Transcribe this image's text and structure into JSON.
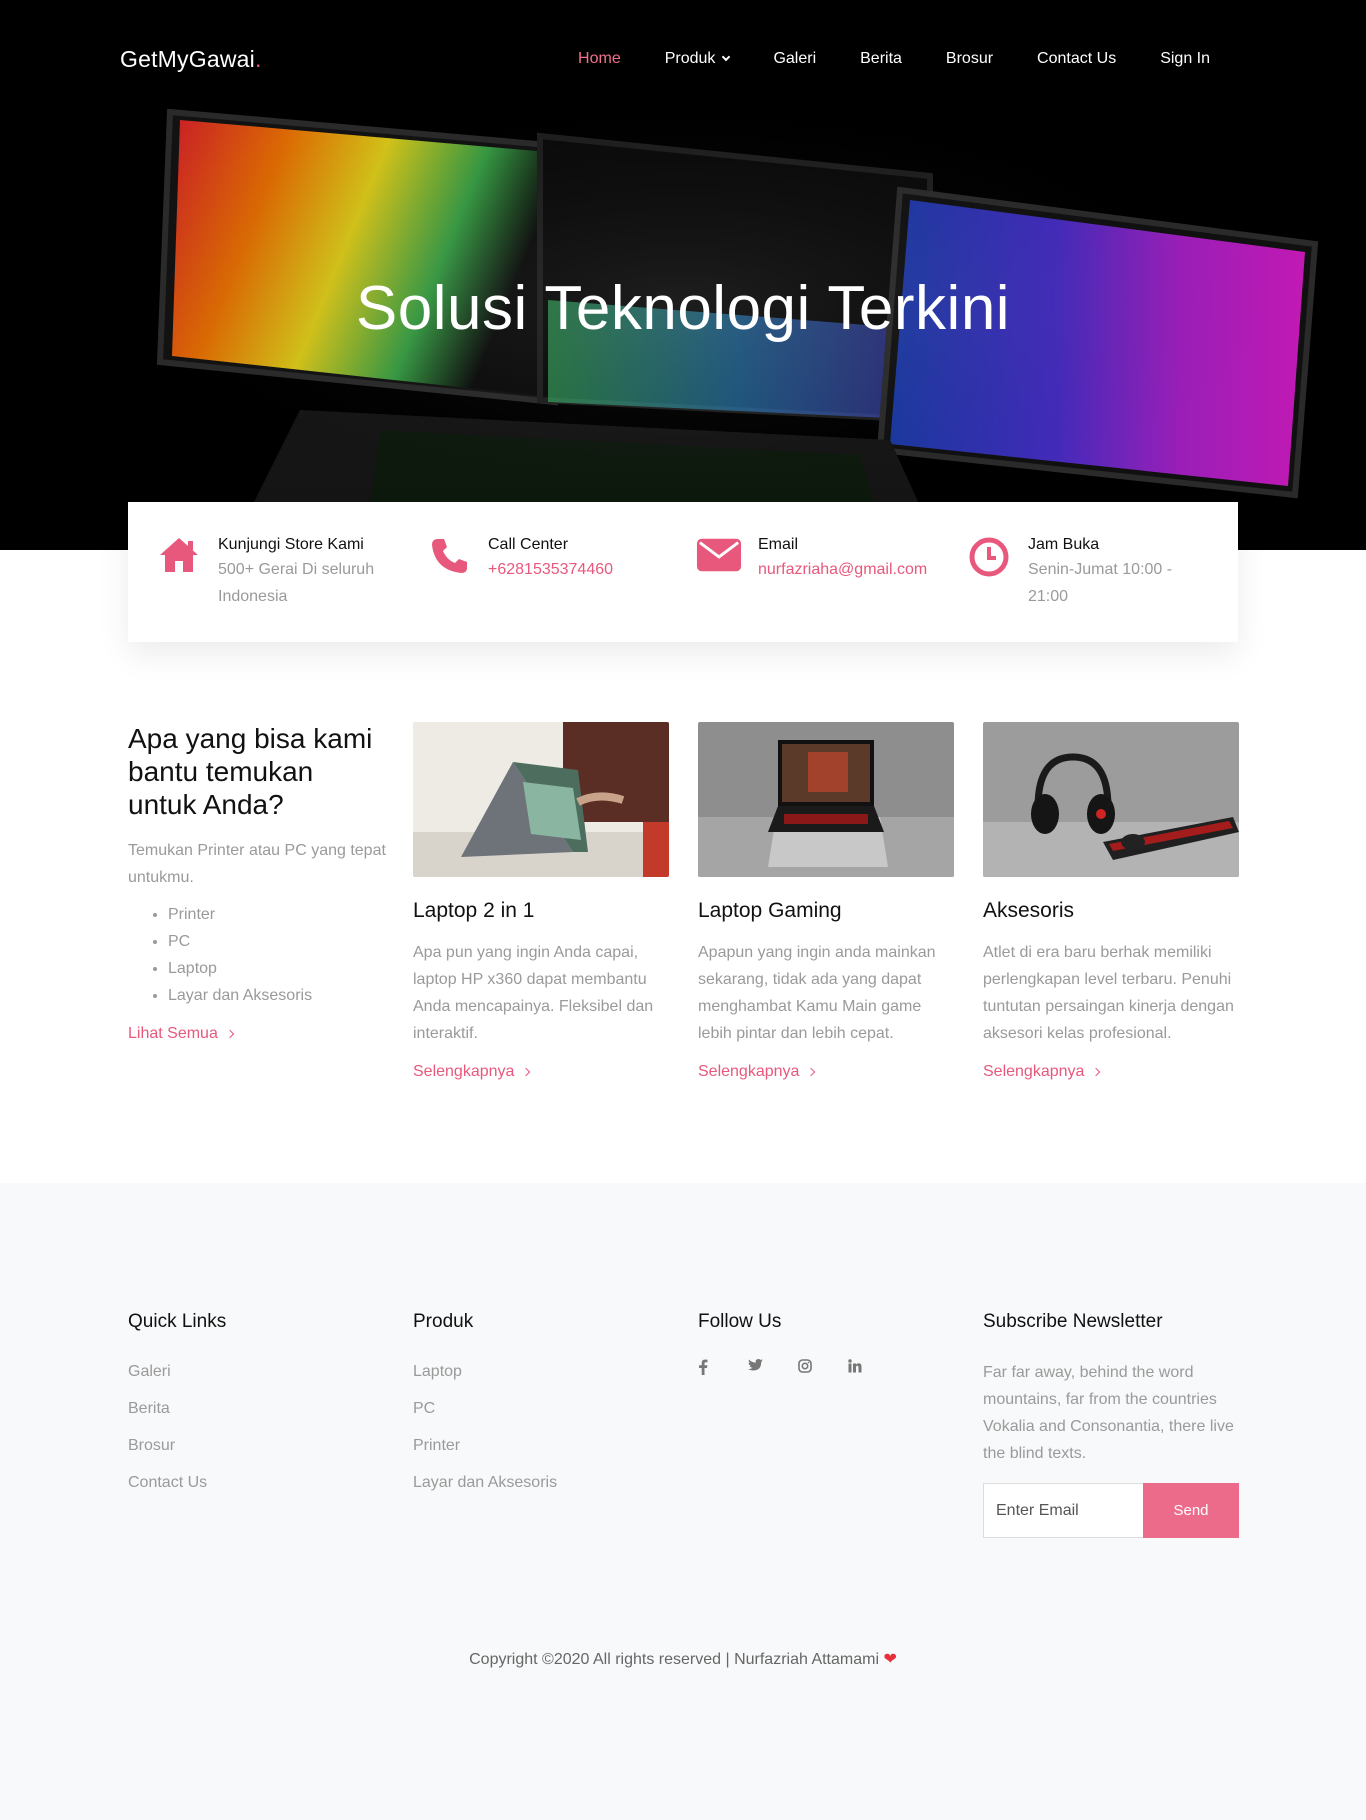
{
  "nav": {
    "brand": "GetMyGawai",
    "brand_dot": ".",
    "items": [
      {
        "label": "Home",
        "active": true
      },
      {
        "label": "Produk",
        "dropdown": true
      },
      {
        "label": "Galeri"
      },
      {
        "label": "Berita"
      },
      {
        "label": "Brosur"
      },
      {
        "label": "Contact Us"
      },
      {
        "label": "Sign In"
      }
    ]
  },
  "hero": {
    "title": "Solusi Teknologi Terkini"
  },
  "info": [
    {
      "icon": "home-icon",
      "title": "Kunjungi Store Kami",
      "text": "500+ Gerai Di seluruh Indonesia"
    },
    {
      "icon": "phone-icon",
      "title": "Call Center",
      "text": "+6281535374460"
    },
    {
      "icon": "envelope-icon",
      "title": "Email",
      "text": "nurfazriaha@gmail.com"
    },
    {
      "icon": "clock-icon",
      "title": "Jam Buka",
      "text": "Senin-Jumat 10:00 - 21:00"
    }
  ],
  "intro": {
    "heading": "Apa yang bisa kami bantu temukan untuk Anda?",
    "text": "Temukan Printer atau PC yang tepat untukmu.",
    "list": [
      "Printer",
      "PC",
      "Laptop",
      "Layar dan Aksesoris"
    ],
    "link": "Lihat Semua"
  },
  "cards": [
    {
      "title": "Laptop 2 in 1",
      "text": "Apa pun yang ingin Anda capai, laptop HP x360 dapat membantu Anda mencapainya. Fleksibel dan interaktif.",
      "link": "Selengkapnya"
    },
    {
      "title": "Laptop Gaming",
      "text": "Apapun yang ingin anda mainkan sekarang, tidak ada yang dapat menghambat Kamu Main game lebih pintar dan lebih cepat.",
      "link": "Selengkapnya"
    },
    {
      "title": "Aksesoris",
      "text": "Atlet di era baru berhak memiliki perlengkapan level terbaru. Penuhi tuntutan persaingan kinerja dengan aksesori kelas profesional.",
      "link": "Selengkapnya"
    }
  ],
  "footer": {
    "quick_links": {
      "title": "Quick Links",
      "items": [
        "Galeri",
        "Berita",
        "Brosur",
        "Contact Us"
      ]
    },
    "produk": {
      "title": "Produk",
      "items": [
        "Laptop",
        "PC",
        "Printer",
        "Layar dan Aksesoris"
      ]
    },
    "follow": {
      "title": "Follow Us",
      "icons": [
        "facebook-icon",
        "twitter-icon",
        "instagram-icon",
        "linkedin-icon"
      ]
    },
    "newsletter": {
      "title": "Subscribe Newsletter",
      "text": "Far far away, behind the word mountains, far from the countries Vokalia and Consonantia, there live the blind texts.",
      "placeholder": "Enter Email",
      "button": "Send"
    },
    "copyright": "Copyright ©2020 All rights reserved | Nurfazriah Attamami"
  },
  "colors": {
    "accent": "#e8587c",
    "hero_bg": "#000000",
    "footer_bg": "#f8f9fa",
    "heart": "#e8303a"
  }
}
